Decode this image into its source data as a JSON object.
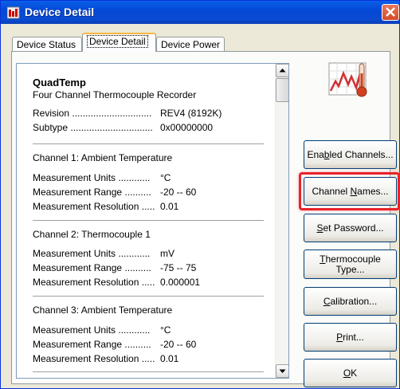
{
  "window": {
    "title": "Device Detail"
  },
  "tabs": [
    {
      "label": "Device Status"
    },
    {
      "label": "Device Detail"
    },
    {
      "label": "Device Power"
    }
  ],
  "device": {
    "name": "QuadTemp",
    "description": "Four Channel Thermocouple Recorder",
    "revision_label": "Revision ..............................",
    "revision_value": "REV4 (8192K)",
    "subtype_label": "Subtype ...............................",
    "subtype_value": "0x00000000"
  },
  "channels": [
    {
      "title": "Channel 1: Ambient Temperature",
      "units_label": "Measurement Units ............",
      "units": "°C",
      "range_label": "Measurement Range ..........",
      "range": "-20 -- 60",
      "resolution_label": "Measurement Resolution .....",
      "resolution": "0.01"
    },
    {
      "title": "Channel 2: Thermocouple  1",
      "units_label": "Measurement Units ............",
      "units": "mV",
      "range_label": "Measurement Range ..........",
      "range": "-75 -- 75",
      "resolution_label": "Measurement Resolution .....",
      "resolution": "0.000001"
    },
    {
      "title": "Channel 3: Ambient Temperature",
      "units_label": "Measurement Units ............",
      "units": "°C",
      "range_label": "Measurement Range ..........",
      "range": "-20 -- 60",
      "resolution_label": "Measurement Resolution .....",
      "resolution": "0.01"
    }
  ],
  "buttons": {
    "enabled_channels_pre": "Ena",
    "enabled_channels_u": "b",
    "enabled_channels_post": "led Channels...",
    "channel_names_pre": "Channel ",
    "channel_names_u": "N",
    "channel_names_post": "ames...",
    "set_password_u": "S",
    "set_password_post": "et Password...",
    "thermocouple_u": "T",
    "thermocouple_post": "hermocouple",
    "thermocouple_line2": "Type...",
    "calibration_u": "C",
    "calibration_post": "alibration...",
    "print_u": "P",
    "print_post": "rint...",
    "ok_u": "O",
    "ok_post": "K"
  },
  "colors": {
    "titlebar": "#0a4bd1",
    "highlight": "#e8232a",
    "close": "#d44a2a"
  }
}
